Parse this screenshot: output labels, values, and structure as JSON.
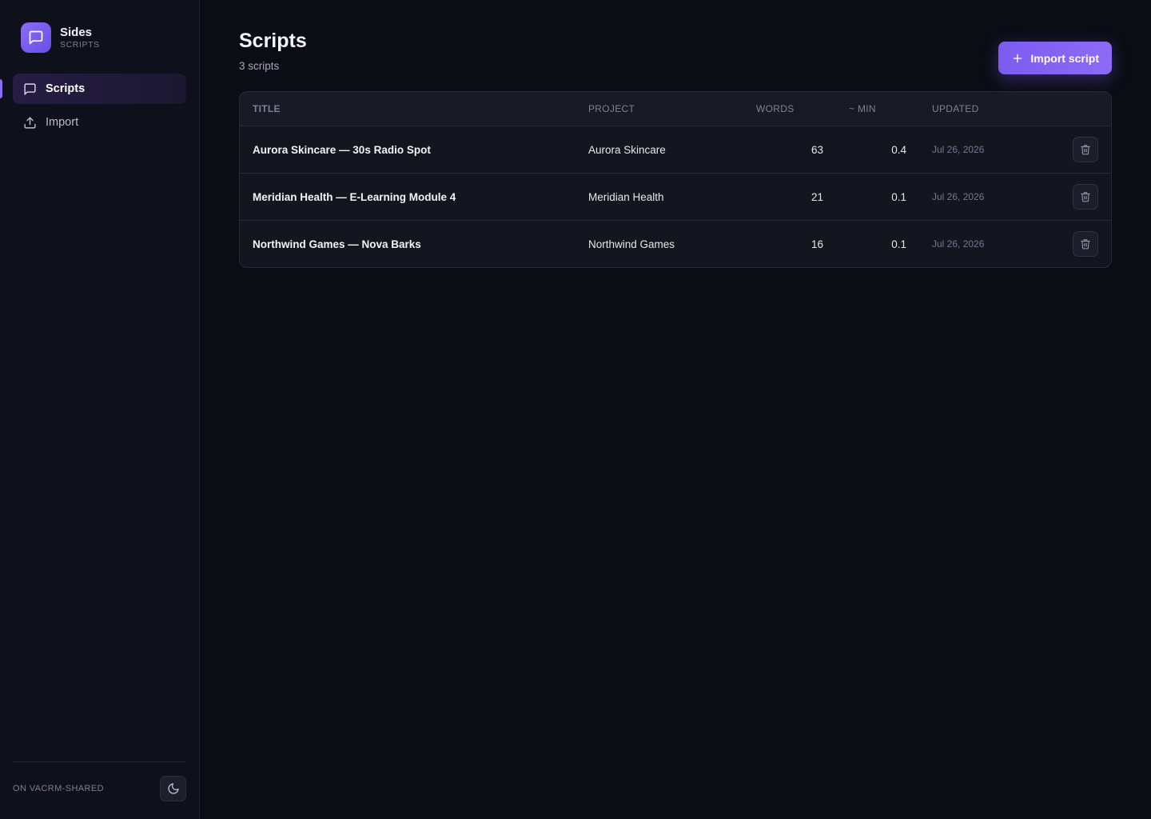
{
  "brand": {
    "name": "Sides",
    "subtitle": "SCRIPTS"
  },
  "nav": {
    "items": [
      {
        "label": "Scripts",
        "icon": "message-square-icon",
        "active": true
      },
      {
        "label": "Import",
        "icon": "upload-icon",
        "active": false
      }
    ]
  },
  "footer": {
    "workspace": "ON VACRM-SHARED",
    "theme_icon": "moon-icon"
  },
  "page": {
    "title": "Scripts",
    "count": "3 scripts",
    "import_label": "Import script"
  },
  "table": {
    "headers": {
      "title": "TITLE",
      "project": "PROJECT",
      "words": "WORDS",
      "min": "~ MIN",
      "updated": "UPDATED"
    },
    "rows": [
      {
        "title": "Aurora Skincare — 30s Radio Spot",
        "project": "Aurora Skincare",
        "words": "63",
        "min": "0.4",
        "updated": "Jul 26, 2026"
      },
      {
        "title": "Meridian Health — E-Learning Module 4",
        "project": "Meridian Health",
        "words": "21",
        "min": "0.1",
        "updated": "Jul 26, 2026"
      },
      {
        "title": "Northwind Games — Nova Barks",
        "project": "Northwind Games",
        "words": "16",
        "min": "0.1",
        "updated": "Jul 26, 2026"
      }
    ]
  },
  "colors": {
    "accent": "#8b6cf7",
    "background": "#0b0d15",
    "sidebar": "#0e111c"
  }
}
